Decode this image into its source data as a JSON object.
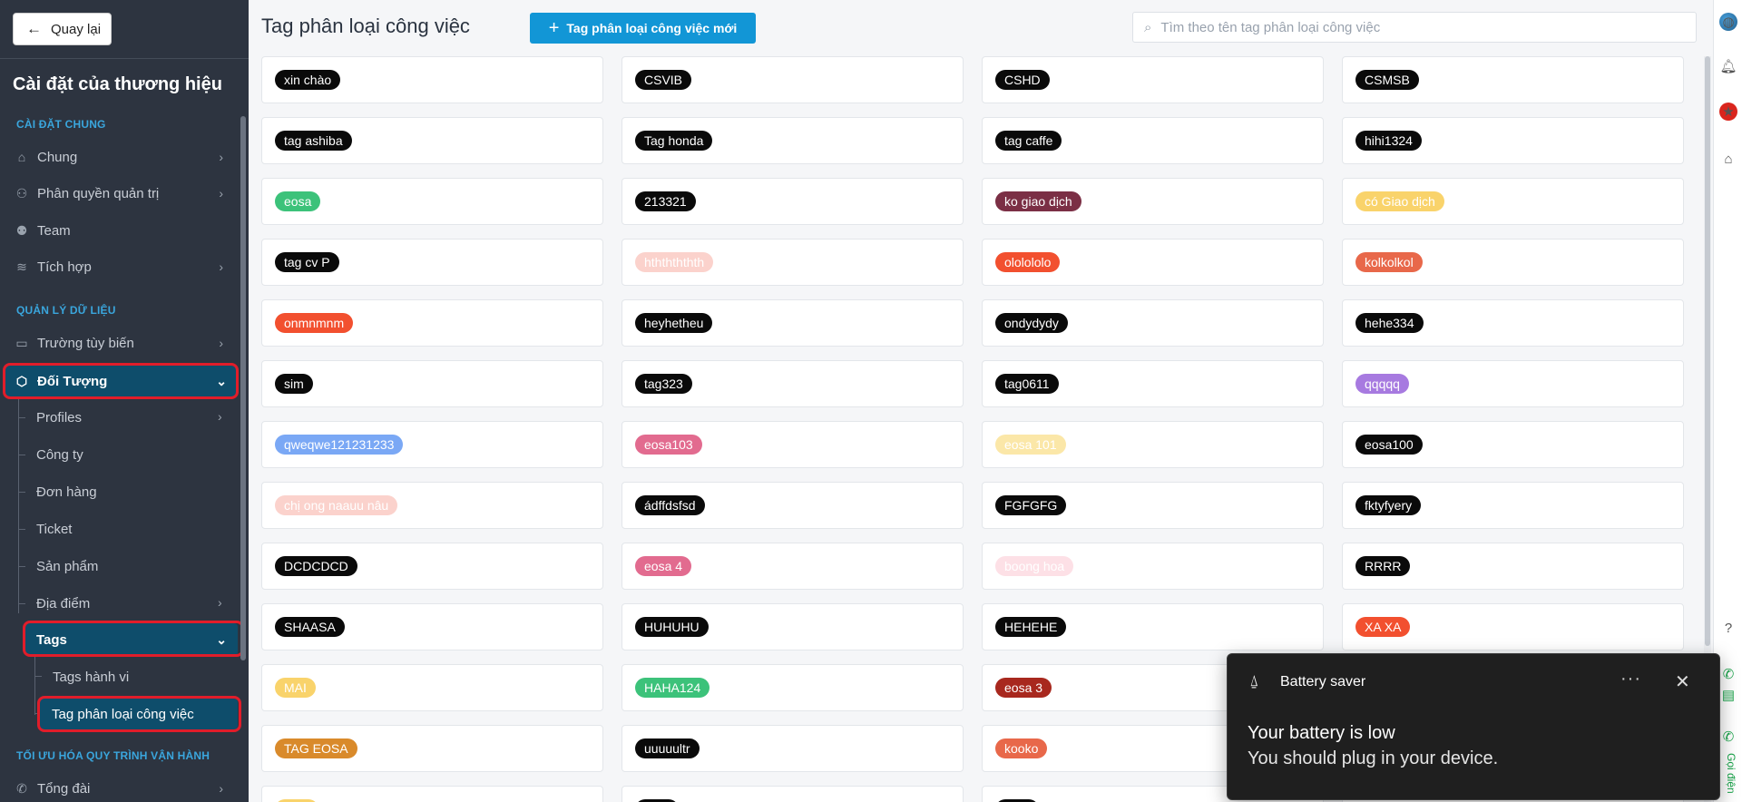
{
  "sidebar": {
    "back_label": "Quay lại",
    "title": "Cài đặt của thương hiệu",
    "section_general": "CÀI ĐẶT CHUNG",
    "section_data": "QUẢN LÝ DỮ LIỆU",
    "section_process": "TỐI ƯU HÓA QUY TRÌNH VẬN HÀNH",
    "items": {
      "chung": "Chung",
      "phan_quyen": "Phân quyền quản trị",
      "team": "Team",
      "tich_hop": "Tích hợp",
      "truong_tuy_bien": "Trường tùy biến",
      "doi_tuong": "Đối Tượng",
      "profiles": "Profiles",
      "cong_ty": "Công ty",
      "don_hang": "Đơn hàng",
      "ticket": "Ticket",
      "san_pham": "Sản phẩm",
      "dia_diem": "Địa điểm",
      "tags": "Tags",
      "tags_hanh_vi": "Tags hành vi",
      "tag_phan_loai": "Tag phân loại công việc",
      "tong_dai": "Tổng đài"
    },
    "active_highlight_color": "#e11d2a"
  },
  "header": {
    "title": "Tag phân loại công việc",
    "new_button": "Tag phân loại công việc mới",
    "search_placeholder": "Tìm theo tên tag phân loại công việc"
  },
  "tags": [
    {
      "label": "xin chào",
      "bg": "#0a0a0a",
      "fg": "#ffffff"
    },
    {
      "label": "CSVIB",
      "bg": "#0a0a0a",
      "fg": "#ffffff"
    },
    {
      "label": "CSHD",
      "bg": "#0a0a0a",
      "fg": "#ffffff"
    },
    {
      "label": "CSMSB",
      "bg": "#0a0a0a",
      "fg": "#ffffff"
    },
    {
      "label": "tag ashiba",
      "bg": "#0a0a0a",
      "fg": "#ffffff"
    },
    {
      "label": "Tag honda",
      "bg": "#0a0a0a",
      "fg": "#ffffff"
    },
    {
      "label": "tag caffe",
      "bg": "#0a0a0a",
      "fg": "#ffffff"
    },
    {
      "label": "hihi1324",
      "bg": "#0a0a0a",
      "fg": "#ffffff"
    },
    {
      "label": "eosa",
      "bg": "#3cc27a",
      "fg": "#ffffff"
    },
    {
      "label": "213321",
      "bg": "#0a0a0a",
      "fg": "#ffffff"
    },
    {
      "label": "ko giao dịch",
      "bg": "#7b2f45",
      "fg": "#ffffff"
    },
    {
      "label": "có Giao dịch",
      "bg": "#f9d36b",
      "fg": "#ffffff"
    },
    {
      "label": "tag cv P",
      "bg": "#0a0a0a",
      "fg": "#ffffff"
    },
    {
      "label": "hththththth",
      "bg": "#fbd2cc",
      "fg": "#ffffff"
    },
    {
      "label": "ololololo",
      "bg": "#f2502f",
      "fg": "#ffffff"
    },
    {
      "label": "kolkolkol",
      "bg": "#e8684a",
      "fg": "#ffffff"
    },
    {
      "label": "onmnmnm",
      "bg": "#f2502f",
      "fg": "#ffffff"
    },
    {
      "label": "heyhetheu",
      "bg": "#0a0a0a",
      "fg": "#ffffff"
    },
    {
      "label": "ondydydy",
      "bg": "#0a0a0a",
      "fg": "#ffffff"
    },
    {
      "label": "hehe334",
      "bg": "#0a0a0a",
      "fg": "#ffffff"
    },
    {
      "label": "sim",
      "bg": "#0a0a0a",
      "fg": "#ffffff"
    },
    {
      "label": "tag323",
      "bg": "#0a0a0a",
      "fg": "#ffffff"
    },
    {
      "label": "tag0611",
      "bg": "#0a0a0a",
      "fg": "#ffffff"
    },
    {
      "label": "qqqqq",
      "bg": "#a77ae0",
      "fg": "#ffffff"
    },
    {
      "label": "qweqwe121231233",
      "bg": "#7aa8f5",
      "fg": "#ffffff"
    },
    {
      "label": "eosa103",
      "bg": "#e26b8f",
      "fg": "#ffffff"
    },
    {
      "label": "eosa 101",
      "bg": "#fbe7a8",
      "fg": "#ffffff"
    },
    {
      "label": "eosa100",
      "bg": "#0a0a0a",
      "fg": "#ffffff"
    },
    {
      "label": "chị ong naauu nâu",
      "bg": "#fbd2cc",
      "fg": "#ffffff"
    },
    {
      "label": "ádffdsfsd",
      "bg": "#0a0a0a",
      "fg": "#ffffff"
    },
    {
      "label": "FGFGFG",
      "bg": "#0a0a0a",
      "fg": "#ffffff"
    },
    {
      "label": "fktyfyery",
      "bg": "#0a0a0a",
      "fg": "#ffffff"
    },
    {
      "label": "DCDCDCD",
      "bg": "#0a0a0a",
      "fg": "#ffffff"
    },
    {
      "label": "eosa 4",
      "bg": "#e26b8f",
      "fg": "#ffffff"
    },
    {
      "label": "boong hoa",
      "bg": "#fde0e6",
      "fg": "#ffffff"
    },
    {
      "label": "RRRR",
      "bg": "#0a0a0a",
      "fg": "#ffffff"
    },
    {
      "label": "SHAASA",
      "bg": "#0a0a0a",
      "fg": "#ffffff"
    },
    {
      "label": "HUHUHU",
      "bg": "#0a0a0a",
      "fg": "#ffffff"
    },
    {
      "label": "HEHEHE",
      "bg": "#0a0a0a",
      "fg": "#ffffff"
    },
    {
      "label": "XA XA",
      "bg": "#f2502f",
      "fg": "#ffffff"
    },
    {
      "label": "MAI",
      "bg": "#f9d36b",
      "fg": "#ffffff"
    },
    {
      "label": "HAHA124",
      "bg": "#3cc27a",
      "fg": "#ffffff"
    },
    {
      "label": "eosa 3",
      "bg": "#a8281e",
      "fg": "#ffffff"
    },
    {
      "label": "",
      "bg": "transparent",
      "fg": "#ffffff"
    },
    {
      "label": "TAG EOSA",
      "bg": "#d98a2b",
      "fg": "#ffffff"
    },
    {
      "label": "uuuuultr",
      "bg": "#0a0a0a",
      "fg": "#ffffff"
    },
    {
      "label": "kooko",
      "bg": "#e8684a",
      "fg": "#ffffff"
    },
    {
      "label": "",
      "bg": "transparent",
      "fg": "#ffffff"
    },
    {
      "label": "",
      "bg": "#f9d36b",
      "fg": "#ffffff"
    },
    {
      "label": "",
      "bg": "#0a0a0a",
      "fg": "#ffffff"
    },
    {
      "label": "",
      "bg": "#0a0a0a",
      "fg": "#ffffff"
    },
    {
      "label": "",
      "bg": "transparent",
      "fg": "#ffffff"
    }
  ],
  "rail": {
    "call_label": "Gọi điện"
  },
  "toast": {
    "title": "Battery saver",
    "more": "···",
    "close": "✕",
    "message": "Your battery is low",
    "detail": "You should plug in your device."
  }
}
